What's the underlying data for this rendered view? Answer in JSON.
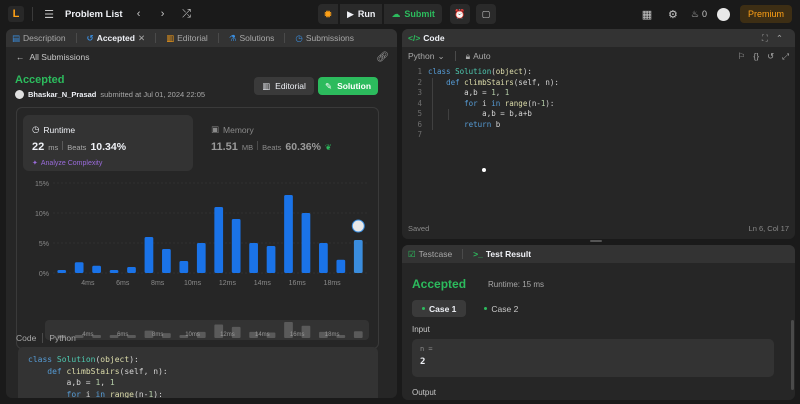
{
  "topbar": {
    "logo_glyph": "L",
    "problem_list": "Problem List",
    "run": "Run",
    "submit": "Submit",
    "streak": "0",
    "premium": "Premium"
  },
  "left_tabs": [
    {
      "label": "Description"
    },
    {
      "label": "Accepted"
    },
    {
      "label": "Editorial"
    },
    {
      "label": "Solutions"
    },
    {
      "label": "Submissions"
    }
  ],
  "submission": {
    "back_label": "All Submissions",
    "status": "Accepted",
    "user": "Bhaskar_N_Prasad",
    "submitted_text": "submitted at Jul 01, 2024 22:05",
    "editorial_btn": "Editorial",
    "solution_btn": "Solution"
  },
  "runtime": {
    "label": "Runtime",
    "value": "22",
    "unit": "ms",
    "beats_label": "Beats",
    "beats_pct": "10.34%",
    "analyze": "Analyze Complexity"
  },
  "memory": {
    "label": "Memory",
    "value": "11.51",
    "unit": "MB",
    "beats_label": "Beats",
    "beats_pct": "60.36%"
  },
  "chart_data": {
    "type": "bar",
    "y_ticks": [
      "15%",
      "10%",
      "5%",
      "0%"
    ],
    "x_tick_labels": [
      "4ms",
      "6ms",
      "8ms",
      "10ms",
      "12ms",
      "14ms",
      "16ms",
      "18ms"
    ],
    "ylim": [
      0,
      15
    ],
    "values": [
      0.5,
      1.8,
      1.2,
      0.5,
      1.0,
      6.0,
      4.0,
      2.0,
      5.0,
      11.0,
      9.0,
      5.0,
      4.5,
      13.0,
      10.0,
      5.0,
      2.2,
      5.5
    ],
    "highlight_index": 17,
    "overview_values": [
      0.5,
      1.8,
      1.2,
      0.5,
      1.0,
      6.0,
      4.0,
      2.0,
      5.0,
      11.0,
      9.0,
      5.0,
      4.5,
      13.0,
      10.0,
      5.0,
      2.2,
      5.5
    ],
    "colors": {
      "bar": "#1a73e8",
      "highlight": "#3a8dde",
      "overview": "#5a5a5a"
    }
  },
  "code_section": {
    "label": "Code",
    "lang": "Python",
    "lines": [
      "class Solution(object):",
      "    def climbStairs(self, n):",
      "        a,b = 1, 1",
      "        for i in range(n-1):"
    ]
  },
  "editor": {
    "title": "Code",
    "lang": "Python",
    "mode": "Auto",
    "lines": [
      "class Solution(object):",
      "    def climbStairs(self, n):",
      "        a,b = 1, 1",
      "        for i in range(n-1):",
      "            a,b = b,a+b",
      "        return b",
      ""
    ],
    "status_left": "Saved",
    "status_right": "Ln 6, Col 17"
  },
  "result": {
    "tab_testcase": "Testcase",
    "tab_result": "Test Result",
    "status": "Accepted",
    "runtime": "Runtime: 15 ms",
    "cases": [
      "Case 1",
      "Case 2"
    ],
    "input_label": "Input",
    "var_name": "n =",
    "var_value": "2",
    "output_label": "Output"
  }
}
